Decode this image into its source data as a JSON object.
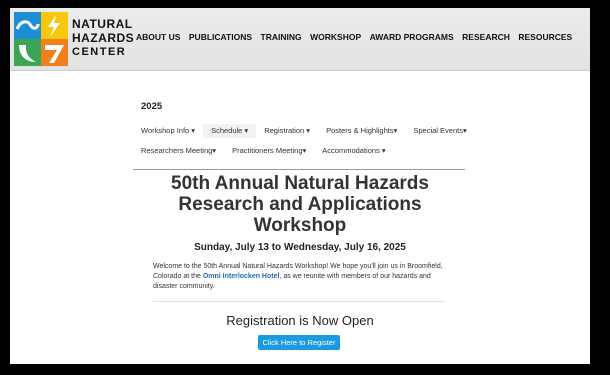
{
  "header": {
    "logo_lines": [
      "NATURAL",
      "HAZARDS",
      "CENTER"
    ],
    "nav": [
      "ABOUT US",
      "PUBLICATIONS",
      "TRAINING",
      "WORKSHOP",
      "AWARD PROGRAMS",
      "RESEARCH",
      "RESOURCES"
    ]
  },
  "page": {
    "year": "2025",
    "subnav_row1": [
      "Workshop Info ▾",
      "Schedule ▾",
      "Registration ▾",
      "Posters & Highlights▾",
      "Special Events▾"
    ],
    "subnav_row2": [
      "Researchers Meeting▾",
      "Practitioners Meeting▾",
      "Accommodations ▾"
    ],
    "title_lines": [
      "50th Annual Natural Hazards",
      "Research and Applications",
      "Workshop"
    ],
    "date": "Sunday, July 13 to Wednesday, July 16, 2025",
    "welcome_pre": "Welcome to the 50th Annual Natural Hazards Workshop! We hope you'll join us in Broomfield, Colorado at the ",
    "welcome_link": "Omni Interlocken Hotel",
    "welcome_post": ", as we reunite with members of our hazards and disaster community.",
    "registration_heading": "Registration is Now Open",
    "register_button": "Click Here to Register"
  },
  "colors": {
    "accent_blue": "#1b9ae0",
    "link_blue": "#1c6fb8",
    "logo_blue": "#1e8fd5",
    "logo_yellow": "#f6c90e",
    "logo_green": "#3aa655",
    "logo_orange": "#f07f1e"
  }
}
